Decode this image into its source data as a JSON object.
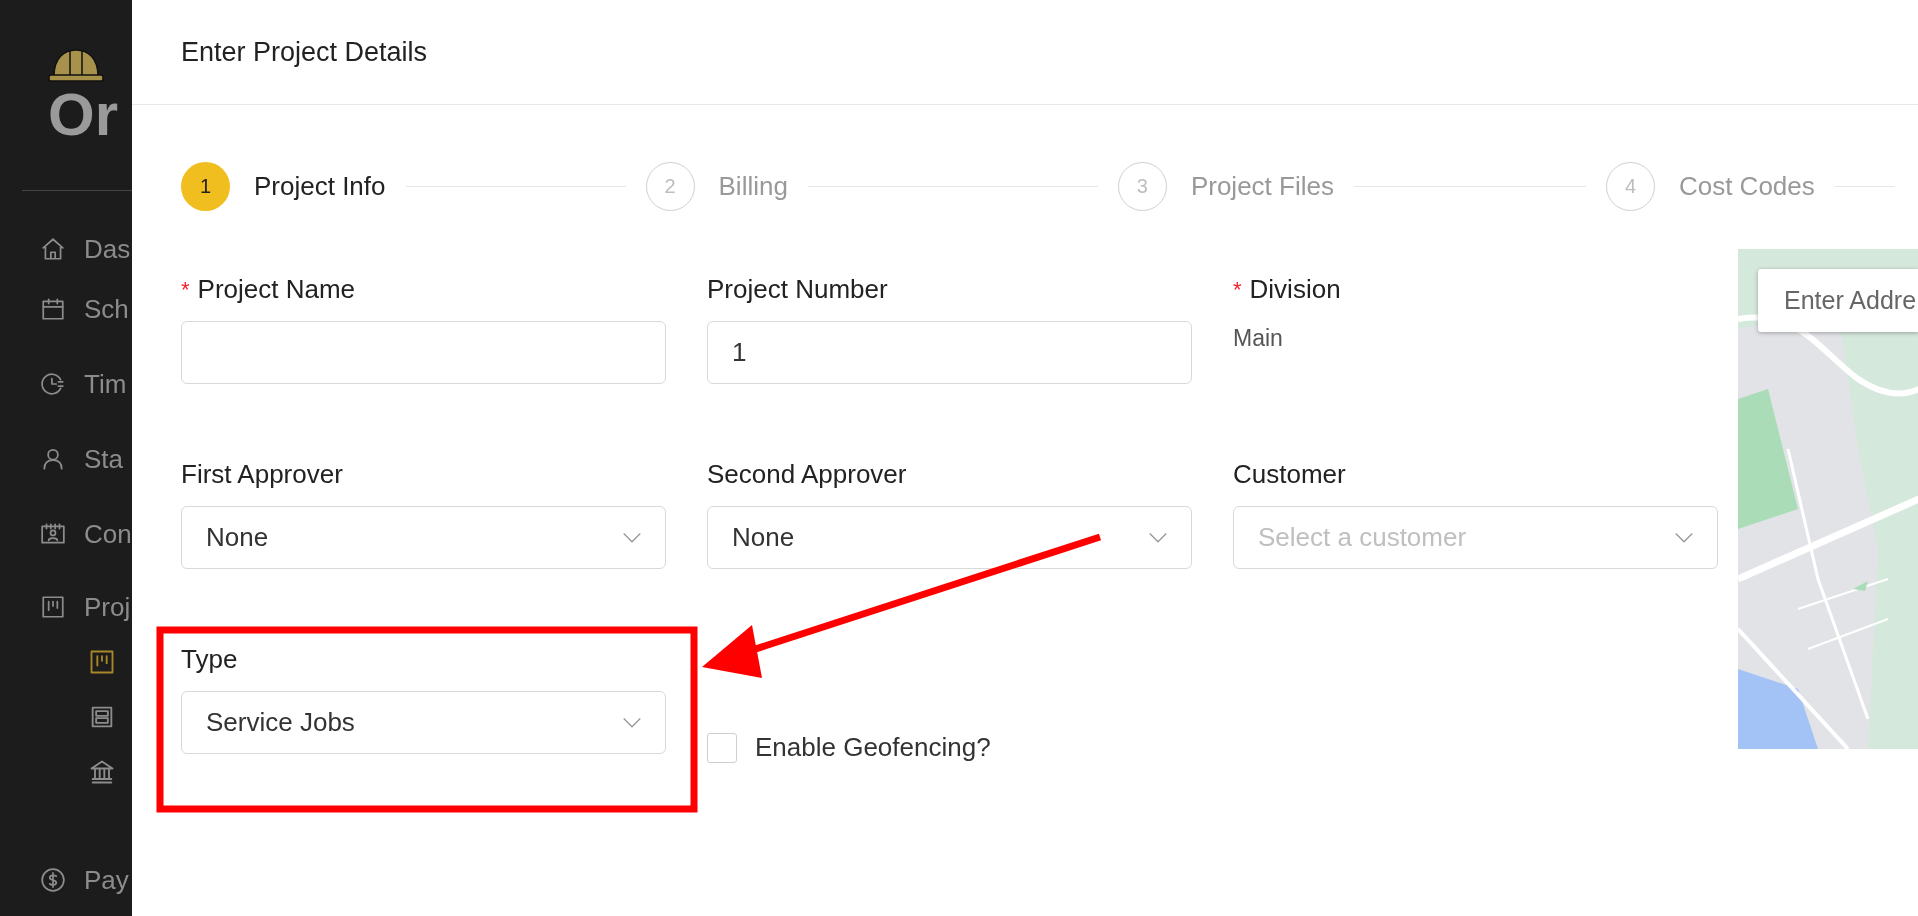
{
  "sidebar": {
    "logo": "Or",
    "items": [
      {
        "label": "Das",
        "selected": false
      },
      {
        "label": "Sch",
        "selected": false
      },
      {
        "label": "Tim",
        "selected": false
      },
      {
        "label": "Sta",
        "selected": false
      },
      {
        "label": "Con",
        "selected": false
      },
      {
        "label": "Proj",
        "selected": false,
        "children": [
          {
            "selected": true
          },
          {
            "selected": false
          },
          {
            "selected": false
          }
        ]
      },
      {
        "label": "Pay",
        "selected": false
      }
    ]
  },
  "modal": {
    "title": "Enter Project Details",
    "steps": [
      {
        "number": "1",
        "label": "Project Info",
        "selected": true
      },
      {
        "number": "2",
        "label": "Billing",
        "selected": false
      },
      {
        "number": "3",
        "label": "Project Files",
        "selected": false
      },
      {
        "number": "4",
        "label": "Cost Codes",
        "selected": false
      }
    ],
    "fields": [
      {
        "kind": "input",
        "label": "Project Name",
        "required_mark": "*"
      },
      {
        "kind": "input",
        "label": "Project Number",
        "value": "1"
      },
      {
        "kind": "text",
        "label": "Division",
        "required_mark": "*",
        "value": "Main"
      },
      {
        "kind": "select",
        "label": "First Approver",
        "value": "None"
      },
      {
        "kind": "select",
        "label": "Second Approver",
        "value": "None"
      },
      {
        "kind": "select",
        "label": "Customer",
        "placeholder": "Select a customer"
      },
      {
        "kind": "select",
        "label": "Type",
        "value": "Service Jobs"
      },
      {
        "kind": "checkbox",
        "label": "Enable Geofencing?",
        "checked": false
      }
    ],
    "map": {
      "search": {
        "placeholder": "Enter Addre"
      }
    }
  }
}
